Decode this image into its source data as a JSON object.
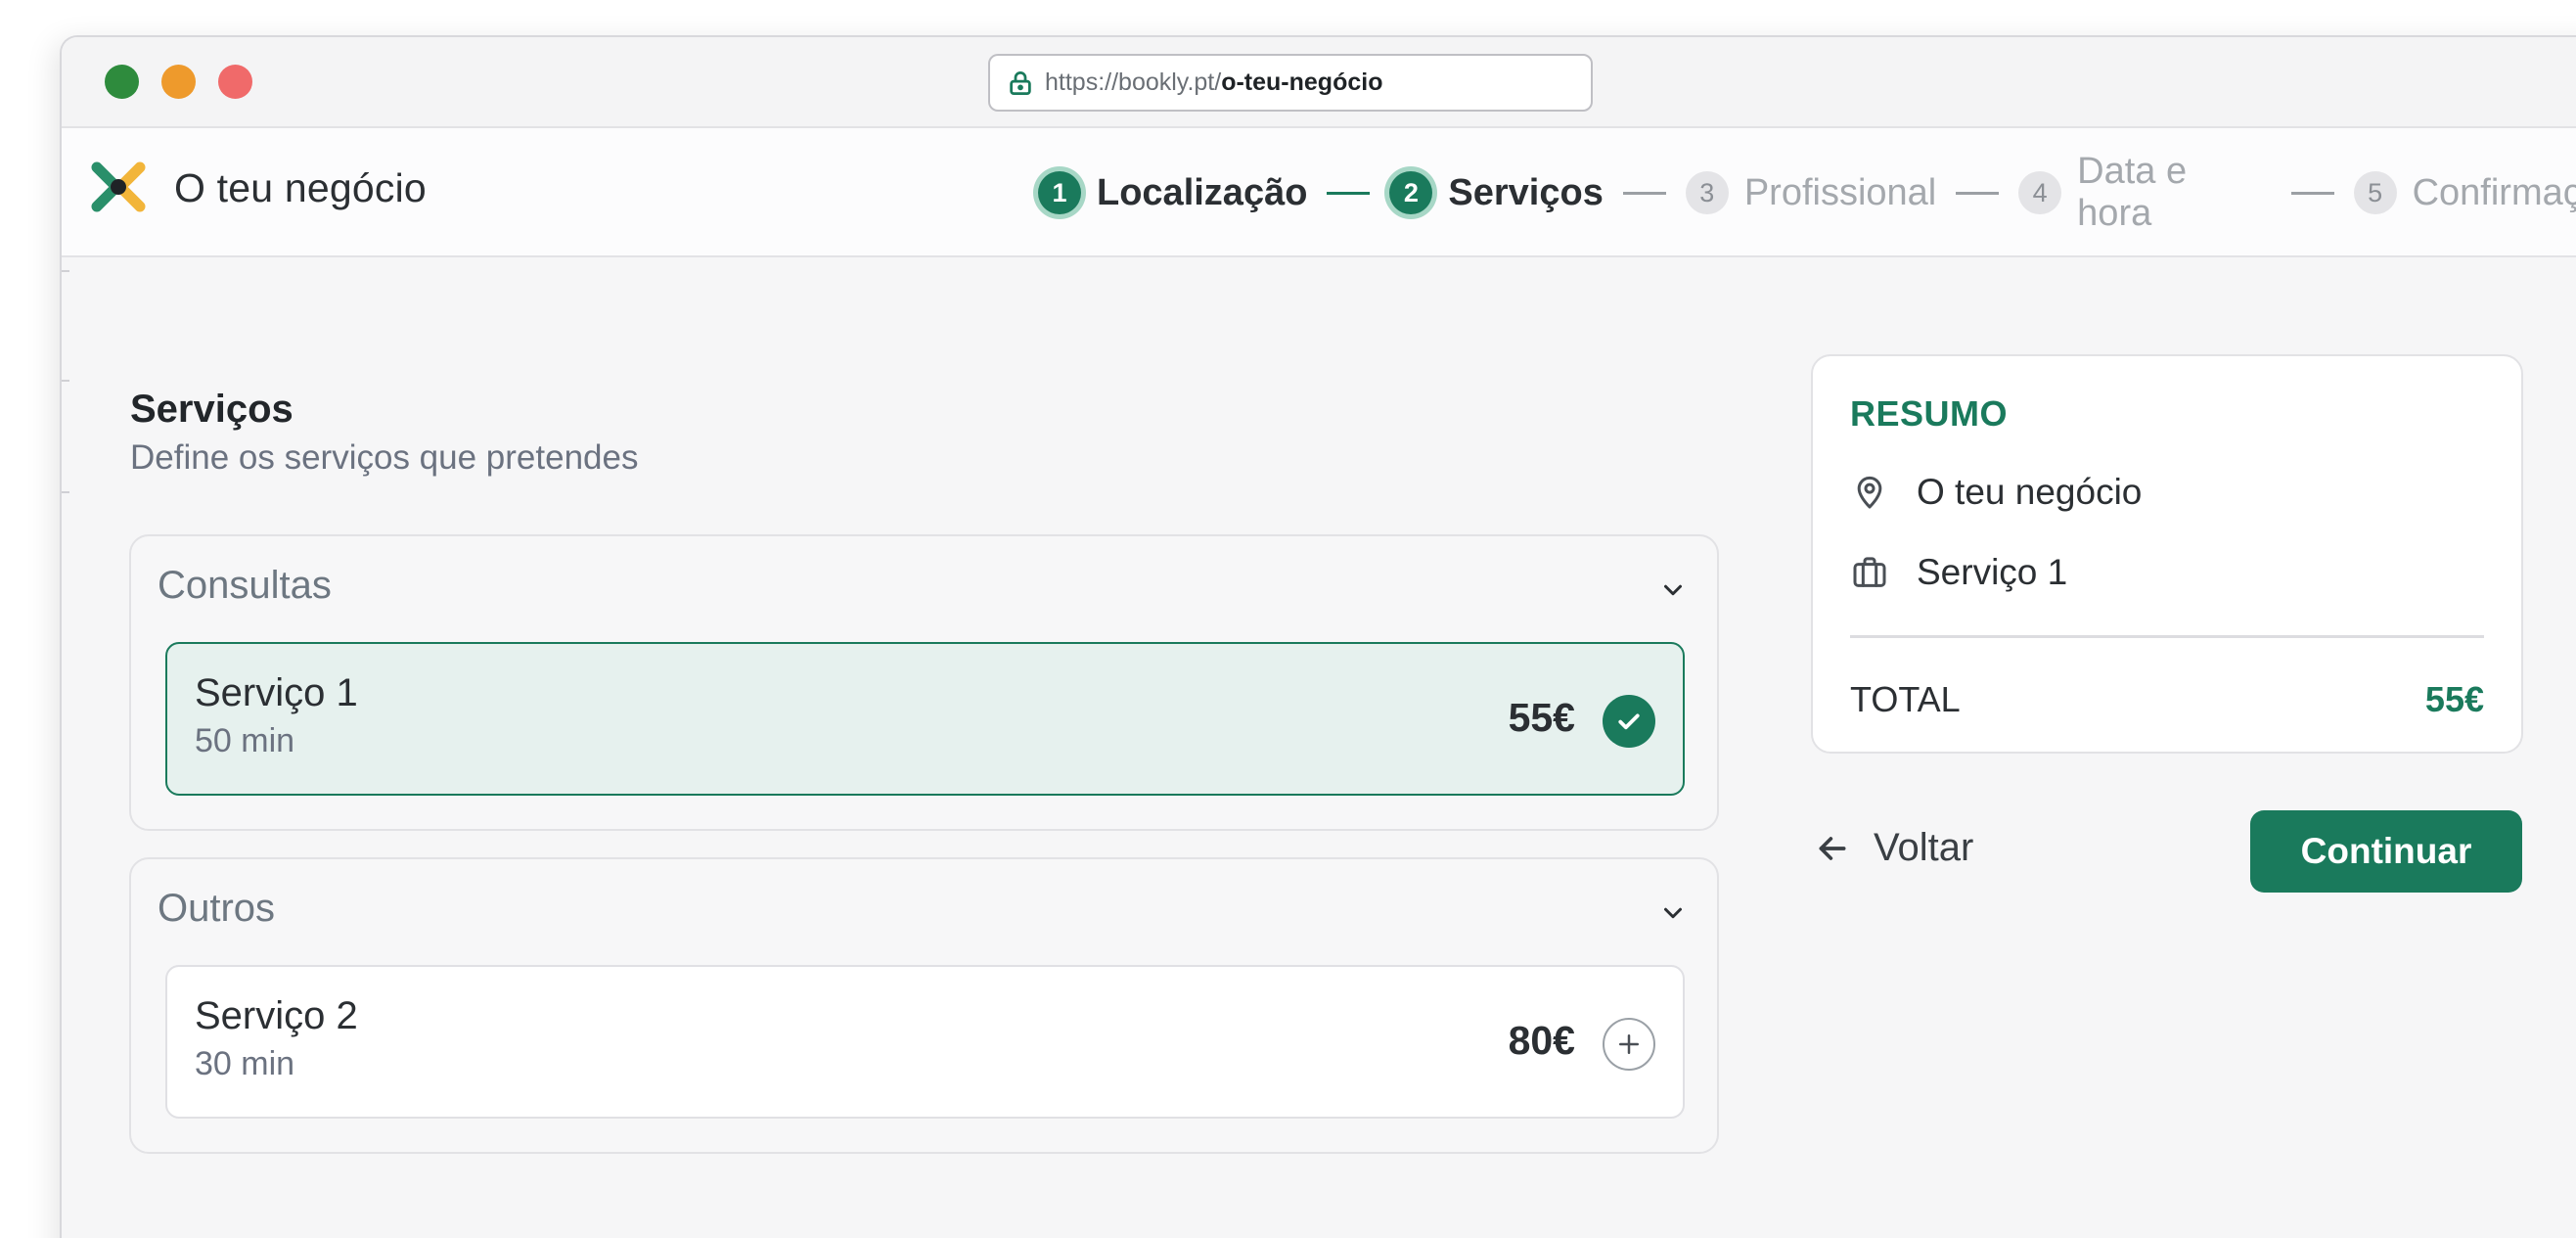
{
  "browser": {
    "url_host": "https://bookly.pt/",
    "url_path": "o-teu-negócio"
  },
  "header": {
    "brand": "O teu negócio",
    "steps": [
      {
        "num": "1",
        "label": "Localização",
        "state": "done"
      },
      {
        "num": "2",
        "label": "Serviços",
        "state": "done"
      },
      {
        "num": "3",
        "label": "Profissional",
        "state": "todo"
      },
      {
        "num": "4",
        "label": "Data e hora",
        "state": "todo"
      },
      {
        "num": "5",
        "label": "Confirmação",
        "state": "todo"
      }
    ]
  },
  "main": {
    "title": "Serviços",
    "subtitle": "Define os serviços que pretendes",
    "groups": [
      {
        "title": "Consultas",
        "services": [
          {
            "name": "Serviço 1",
            "duration": "50 min",
            "price": "55€",
            "selected": true
          }
        ]
      },
      {
        "title": "Outros",
        "services": [
          {
            "name": "Serviço 2",
            "duration": "30 min",
            "price": "80€",
            "selected": false
          }
        ]
      }
    ]
  },
  "summary": {
    "title": "RESUMO",
    "location": "O teu negócio",
    "service": "Serviço 1",
    "total_label": "TOTAL",
    "total_value": "55€"
  },
  "actions": {
    "back_label": "Voltar",
    "continue_label": "Continuar"
  },
  "colors": {
    "accent": "#1a7a5c",
    "selected_bg": "#e6f1ee"
  },
  "icons": {
    "lock": "lock-icon",
    "location": "location-pin-icon",
    "service": "briefcase-icon",
    "chevron": "chevron-down-icon",
    "check": "check-icon",
    "add": "plus-icon",
    "back": "arrow-left-icon"
  }
}
